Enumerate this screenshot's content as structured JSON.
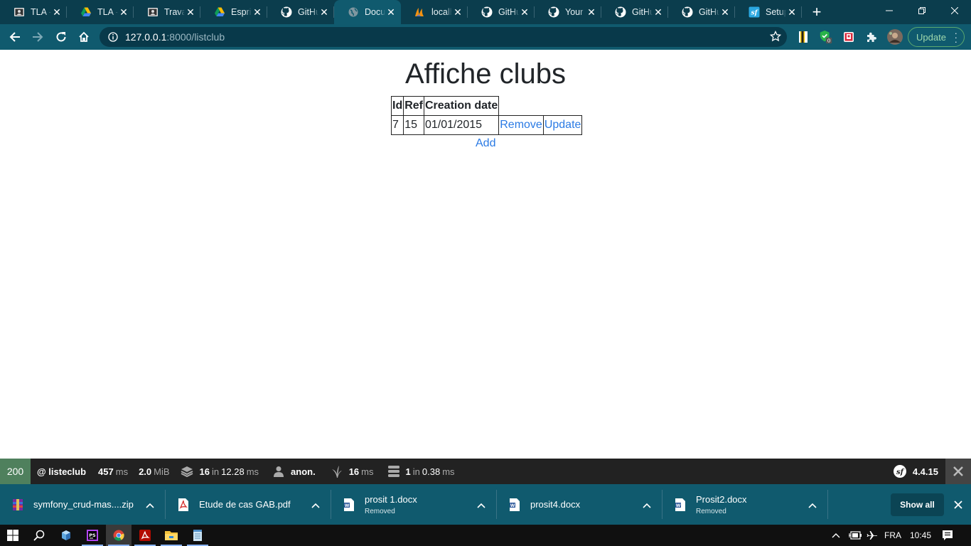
{
  "browser": {
    "tabs": [
      {
        "title": "TLA -",
        "icon": "portrait-icon",
        "active": false
      },
      {
        "title": "TLA -",
        "icon": "google-drive-icon",
        "active": false
      },
      {
        "title": "Travail",
        "icon": "portrait-icon",
        "active": false
      },
      {
        "title": "Esprit",
        "icon": "google-drive-icon",
        "active": false
      },
      {
        "title": "GitHub",
        "icon": "github-icon",
        "active": false
      },
      {
        "title": "Document",
        "icon": "globe-icon",
        "active": true
      },
      {
        "title": "localhost",
        "icon": "phpmyadmin-icon",
        "active": false
      },
      {
        "title": "GitHub",
        "icon": "github-icon",
        "active": false
      },
      {
        "title": "Your Repos",
        "icon": "github-icon",
        "active": false
      },
      {
        "title": "GitHub",
        "icon": "github-icon",
        "active": false
      },
      {
        "title": "GitHub",
        "icon": "github-icon",
        "active": false
      },
      {
        "title": "Setup",
        "icon": "symfony-icon",
        "active": false
      }
    ],
    "url_host": "127.0.0.1",
    "url_rest": ":8000/listclub",
    "update_label": "Update",
    "extension_badge": "0"
  },
  "page": {
    "title": "Affiche clubs",
    "table": {
      "headers": [
        "Id",
        "Ref",
        "Creation date"
      ],
      "rows": [
        {
          "id": "7",
          "ref": "15",
          "creation_date": "01/01/2015",
          "remove_label": "Remove",
          "update_label": "Update"
        }
      ]
    },
    "add_label": "Add"
  },
  "debug_toolbar": {
    "status_code": "200",
    "route": "@ listeclub",
    "time_value": "457",
    "time_unit": "ms",
    "memory_value": "2.0",
    "memory_unit": "MiB",
    "forms_count": "16",
    "forms_in": "in",
    "forms_time": "12.28",
    "forms_unit": "ms",
    "user": "anon.",
    "twig_time": "16",
    "twig_unit": "ms",
    "db_count": "1",
    "db_in": "in",
    "db_time": "0.38",
    "db_unit": "ms",
    "symfony_version": "4.4.15",
    "status_color": "#4f805d"
  },
  "downloads": {
    "items": [
      {
        "name": "symfony_crud-mas....zip",
        "status": "",
        "icon": "zip-archive-icon"
      },
      {
        "name": "Etude de cas GAB.pdf",
        "status": "",
        "icon": "pdf-icon"
      },
      {
        "name": "prosit 1.docx",
        "status": "Removed",
        "icon": "word-doc-icon"
      },
      {
        "name": "prosit4.docx",
        "status": "",
        "icon": "word-doc-icon"
      },
      {
        "name": "Prosit2.docx",
        "status": "Removed",
        "icon": "word-doc-icon"
      }
    ],
    "show_all_label": "Show all"
  },
  "taskbar": {
    "language": "FRA",
    "time": "10:45"
  },
  "colors": {
    "tabstrip": "#0b3d4d",
    "toolbar": "#105a6e",
    "link": "#2a7ae4",
    "debug_bar": "#222222"
  }
}
